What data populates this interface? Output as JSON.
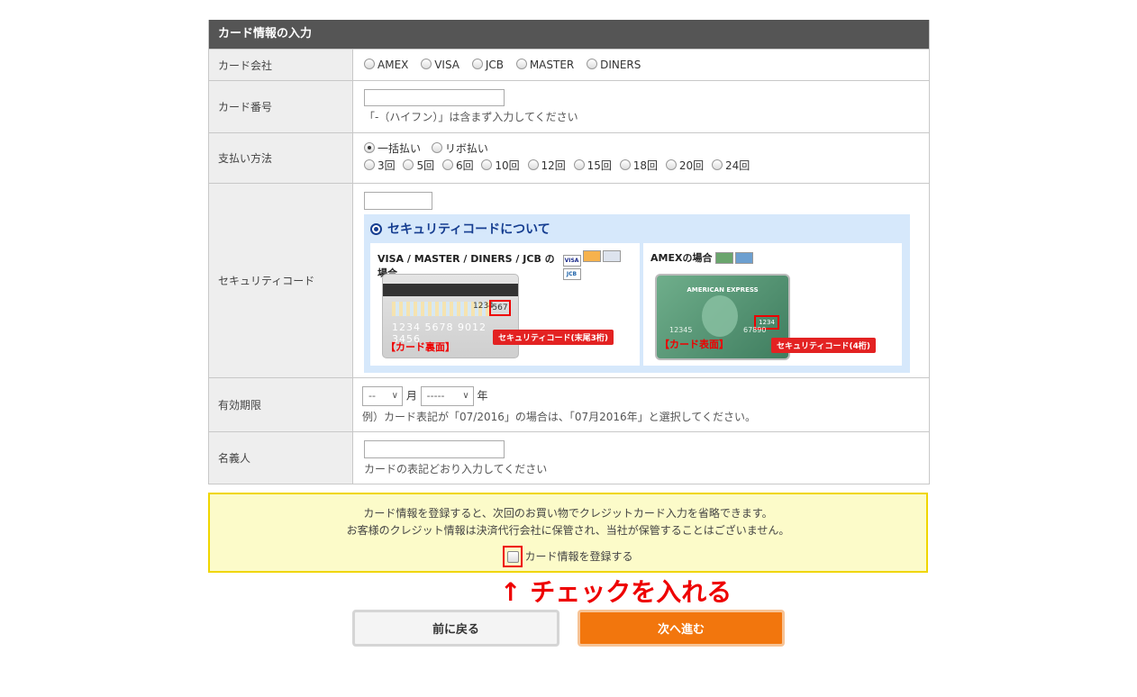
{
  "form": {
    "header": "カード情報の入力",
    "company": {
      "label": "カード会社",
      "options": [
        "AMEX",
        "VISA",
        "JCB",
        "MASTER",
        "DINERS"
      ]
    },
    "number": {
      "label": "カード番号",
      "value": "",
      "hint": "「-（ハイフン）」は含まず入力してください"
    },
    "payment": {
      "label": "支払い方法",
      "main_options": [
        "一括払い",
        "リボ払い"
      ],
      "installments": [
        "3回",
        "5回",
        "6回",
        "10回",
        "12回",
        "15回",
        "18回",
        "20回",
        "24回"
      ]
    },
    "security": {
      "label": "セキュリティコード",
      "value": "",
      "about_title": "セキュリティコードについて",
      "visa_title": "VISA / MASTER / DINERS / JCB の場合",
      "visa_back_label": "【カード裏面】",
      "visa_code_label": "セキュリティコード(末尾3桁)",
      "visa_numbers": "1234 5678 9012 3456",
      "visa_sig": "1234",
      "visa_cvc": "567",
      "amex_title": "AMEXの場合",
      "amex_front_label": "【カード表面】",
      "amex_code_label": "セキュリティコード(4桁)",
      "amex_brand": "AMERICAN EXPRESS",
      "amex_code": "1234",
      "amex_num": "12345",
      "amex_num2": "67890"
    },
    "expiry": {
      "label": "有効期限",
      "month_value": "--",
      "month_unit": "月",
      "year_value": "-----",
      "year_unit": "年",
      "hint": "例）カード表記が「07/2016」の場合は、「07月2016年」と選択してください。"
    },
    "holder": {
      "label": "名義人",
      "value": "",
      "hint": "カードの表記どおり入力してください"
    }
  },
  "notice": {
    "line1": "カード情報を登録すると、次回のお買い物でクレジットカード入力を省略できます。",
    "line2": "お客様のクレジット情報は決済代行会社に保管され、当社が保管することはございません。",
    "checkbox_label": "カード情報を登録する"
  },
  "annotation": "↑ チェックを入れる",
  "buttons": {
    "back": "前に戻る",
    "next": "次へ進む"
  },
  "colors": {
    "header_bg": "#555555",
    "accent_orange": "#f2760d",
    "annotation_red": "#ee0000",
    "notice_bg": "#fcfbc9",
    "security_blue": "#163e91"
  }
}
